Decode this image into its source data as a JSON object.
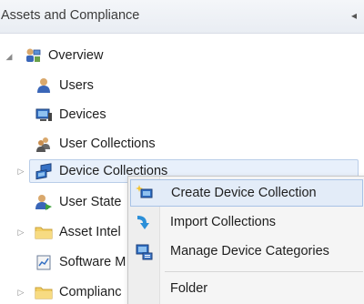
{
  "pane": {
    "title": "Assets and Compliance",
    "collapse_glyph": "◂"
  },
  "tree": {
    "overview": "Overview",
    "users": "Users",
    "devices": "Devices",
    "user_collections": "User Collections",
    "device_collections": "Device Collections",
    "user_state": "User State",
    "asset_intel": "Asset Intel",
    "software": "Software M",
    "compliance": "Complianc"
  },
  "context_menu": {
    "items": [
      {
        "label": "Create Device Collection",
        "icon": "create-collection-icon"
      },
      {
        "label": "Import Collections",
        "icon": "import-arrow-icon"
      },
      {
        "label": "Manage Device Categories",
        "icon": "manage-categories-icon"
      },
      {
        "label": "Folder",
        "icon": ""
      }
    ]
  },
  "colors": {
    "selection_bg": "#e8f0fb",
    "menu_hover_bg": "#e3ecf8",
    "folder_yellow": "#f2cf63",
    "device_blue": "#2f6fc5"
  }
}
